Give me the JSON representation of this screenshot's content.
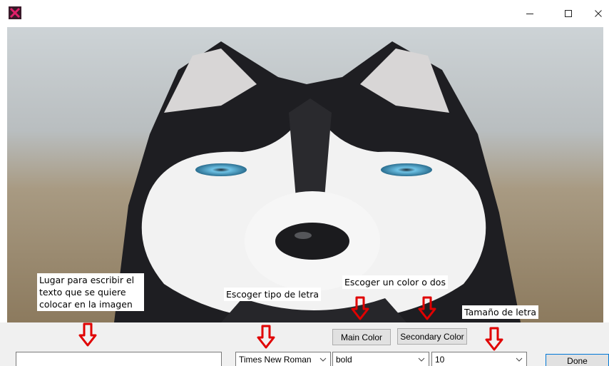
{
  "window": {
    "icon": "x-app-icon",
    "controls": [
      "minimize-icon",
      "maximize-icon",
      "close-icon"
    ]
  },
  "image": {
    "subject": "husky-photo-icon"
  },
  "annotations": {
    "text_note": "Lugar para escribir el texto que se quiere colocar en la imagen",
    "font_note": "Escoger tipo de letra",
    "color_note": "Escoger un color o dos",
    "size_note": "Tamaño de letra"
  },
  "controls": {
    "text_input_value": "",
    "font_family": "Times New Roman",
    "font_weight": "bold",
    "font_size": "10",
    "main_color_label": "Main Color",
    "secondary_color_label": "Secondary Color",
    "done_label": "Done"
  },
  "colors": {
    "arrow": "#e00000",
    "app_icon": "#c2185b"
  }
}
